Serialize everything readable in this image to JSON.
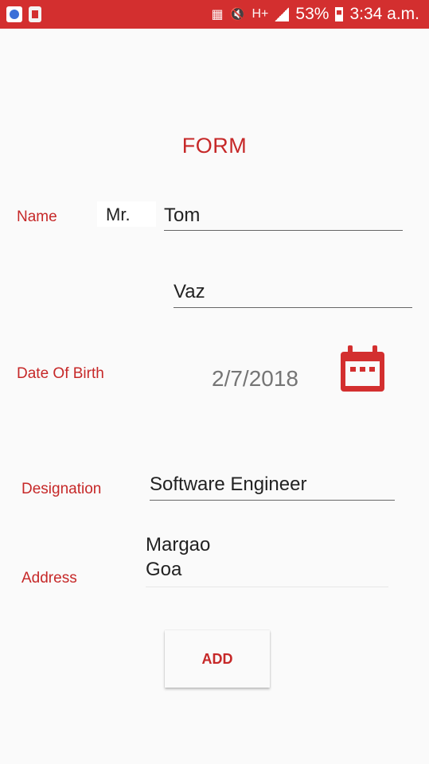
{
  "status_bar": {
    "battery": "53%",
    "time": "3:34 a.m.",
    "network": "H+",
    "icons": [
      "app-icon",
      "app-icon",
      "cast-icon",
      "mute-icon",
      "network-h-plus-icon",
      "signal-icon",
      "battery-icon"
    ]
  },
  "form": {
    "title": "FORM",
    "name_label": "Name",
    "prefix": "Mr.",
    "first_name": "Tom",
    "last_name": "Vaz",
    "dob_label": "Date Of Birth",
    "dob_value": "2/7/2018",
    "dob_icon": "calendar-icon",
    "designation_label": "Designation",
    "designation_value": "Software Engineer",
    "address_label": "Address",
    "address_line1": "Margao",
    "address_line2": "Goa",
    "add_button": "ADD"
  },
  "colors": {
    "accent": "#c62828",
    "status_bar": "#d32f2f"
  }
}
